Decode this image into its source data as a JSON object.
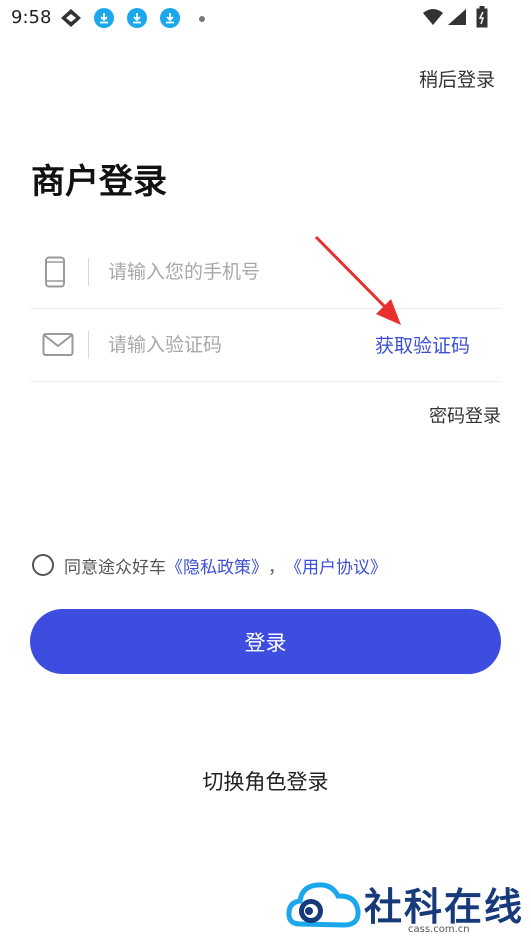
{
  "status_bar": {
    "time": "9:58",
    "icons": [
      "diamond-app-icon",
      "download-icon",
      "download-icon",
      "download-icon",
      "dot-icon",
      "wifi-icon",
      "signal-icon",
      "battery-icon"
    ]
  },
  "header": {
    "skip_label": "稍后登录"
  },
  "title": "商户登录",
  "form": {
    "phone_placeholder": "请输入您的手机号",
    "phone_value": "",
    "code_placeholder": "请输入验证码",
    "code_value": "",
    "get_code_label": "获取验证码",
    "password_login_label": "密码登录"
  },
  "agreement": {
    "prefix": "同意途众好车",
    "privacy_link": "《隐私政策》",
    "separator": "，",
    "user_link": "《用户协议》"
  },
  "login_button_label": "登录",
  "switch_role_label": "切换角色登录",
  "watermark": {
    "text": "社科在线",
    "sub": "cass.com.cn"
  },
  "colors": {
    "primary": "#3c4de0",
    "link": "#3b4fd8",
    "arrow": "#e8312f"
  }
}
